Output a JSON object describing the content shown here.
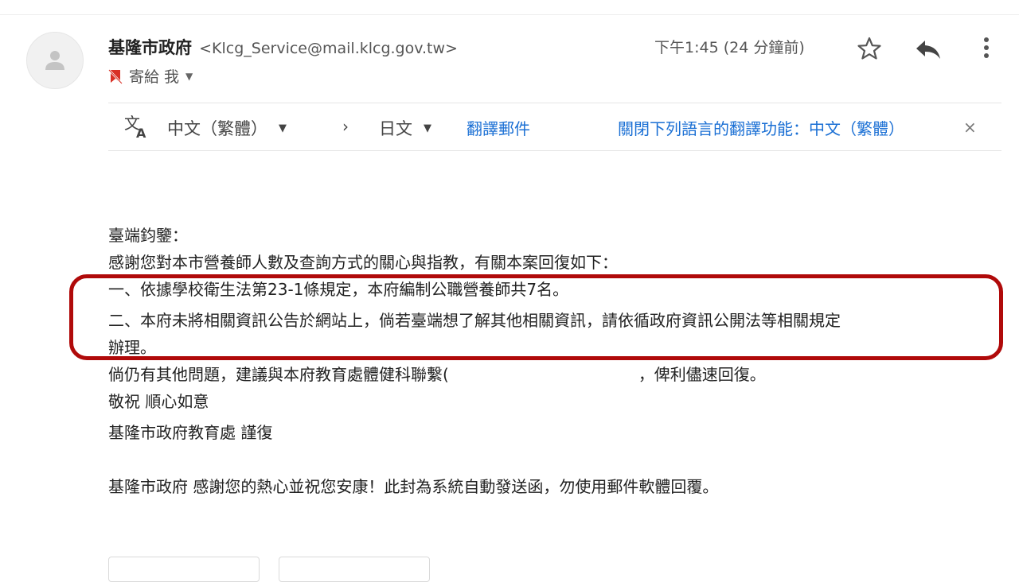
{
  "email": {
    "sender_name": "基隆市政府",
    "sender_email": "<Klcg_Service@mail.klcg.gov.tw>",
    "recipient_label": "寄給 我",
    "timestamp": "下午1:45 (24 分鐘前)",
    "icons": {
      "avatar": "person-icon",
      "star": "star-icon",
      "reply": "reply-icon",
      "more": "more-vert-icon",
      "recipient_flag": "important-marker-icon",
      "translate": "translate-icon"
    }
  },
  "translate_bar": {
    "source_language": "中文（繁體）",
    "arrow": "›",
    "target_language": "日文",
    "translate_link": "翻譯郵件",
    "turn_off_link": "關閉下列語言的翻譯功能：中文（繁體）",
    "close": "×"
  },
  "body_lines": [
    "臺端鈞鑒：",
    "感謝您對本市營養師人數及查詢方式的關心與指教，有關本案回復如下：",
    "一、依據學校衛生法第23-1條規定，本府編制公職營養師共7名。",
    "二、本府未將相關資訊公告於網站上，倘若臺端想了解其他相關資訊，請依循政府資訊公開法等相關規定",
    "辦理。",
    "倘仍有其他問題，建議與本府教育處體健科聯繫(",
    "，俾利儘速回復。",
    "敬祝 順心如意",
    "基隆市政府教育處 謹復",
    "基隆市政府 感謝您的熱心並祝您安康！此封為系統自動發送函，勿使用郵件軟體回覆。"
  ],
  "colors": {
    "highlight_border": "#b00a0a",
    "link": "#1a6fd4",
    "important_marker": "#d93025"
  }
}
